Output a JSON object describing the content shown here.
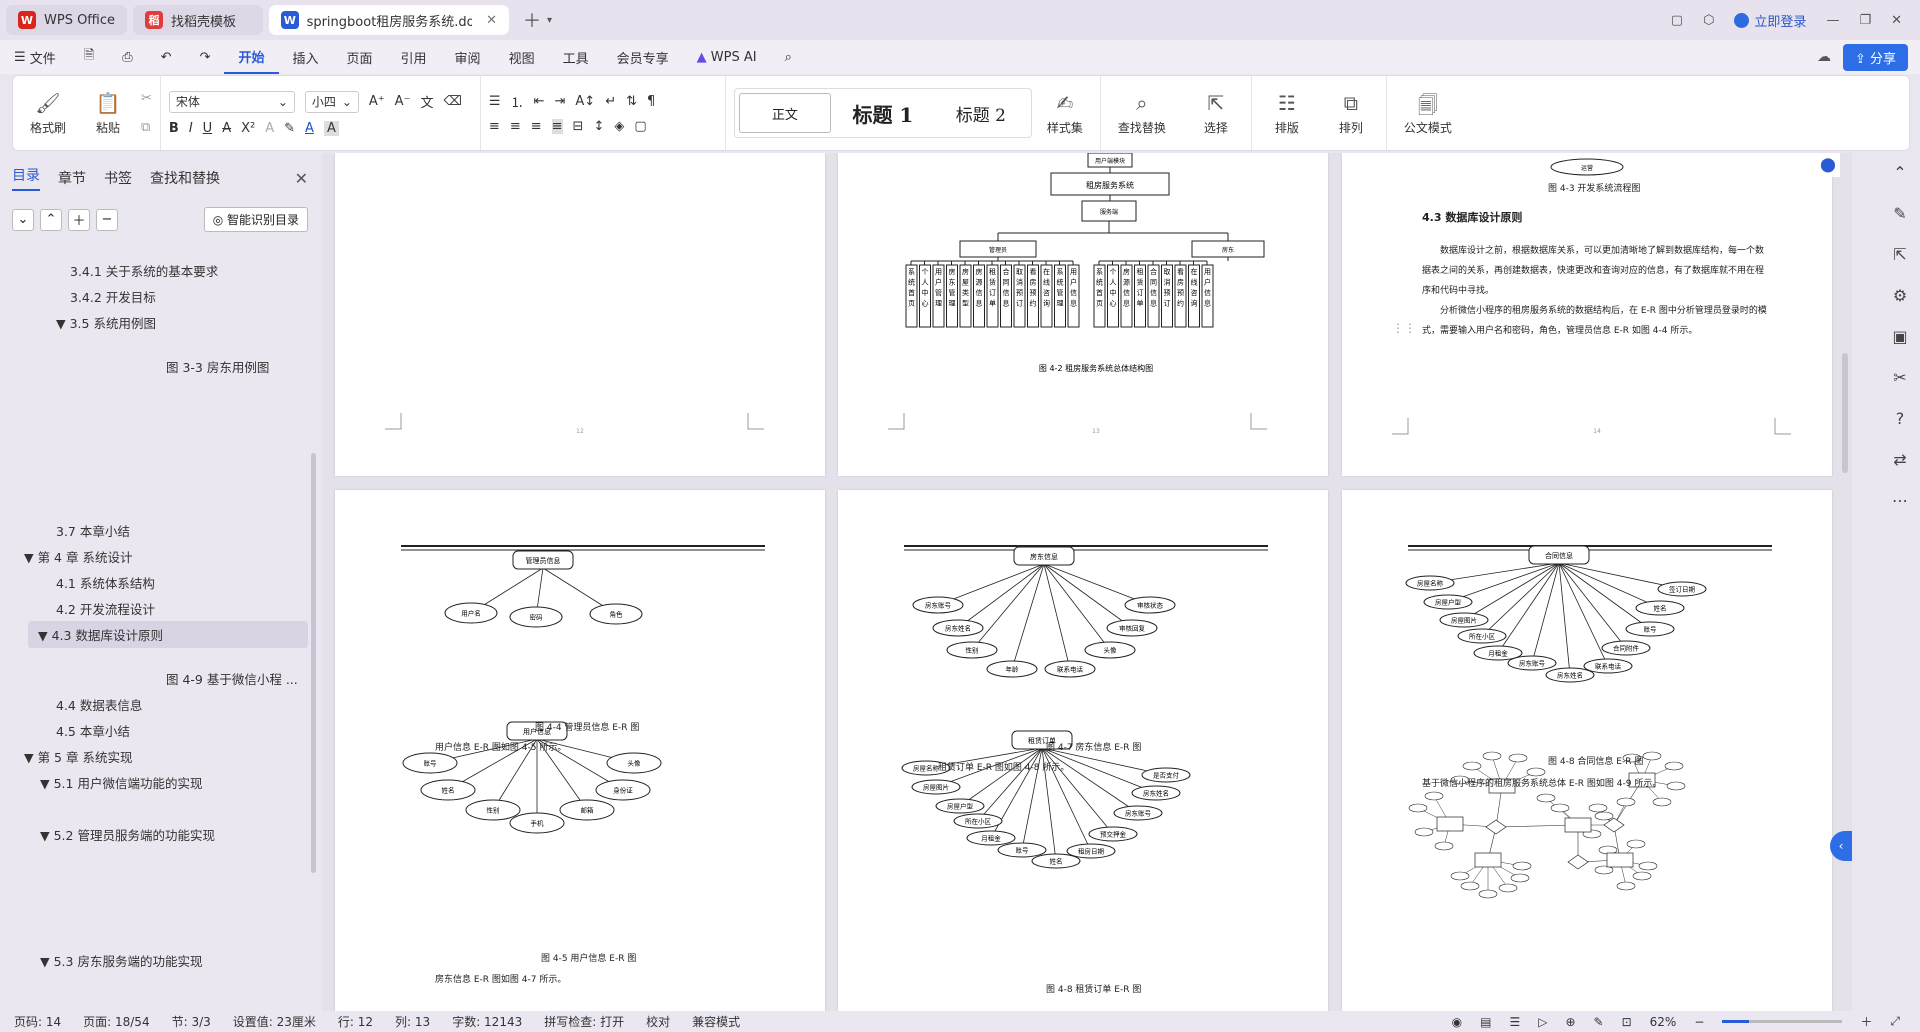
{
  "titlebar": {
    "tabs": [
      {
        "label": "WPS Office",
        "icon": "wps-logo-icon",
        "color": "#d9261c"
      },
      {
        "label": "找稻壳模板",
        "icon": "docer-icon",
        "color": "#e23b3b"
      },
      {
        "label": "springboot租房服务系统.doc",
        "icon": "word-doc-icon",
        "color": "#2a5bd7"
      }
    ],
    "login": "立即登录"
  },
  "menu": {
    "file": "文件",
    "items": [
      "开始",
      "插入",
      "页面",
      "引用",
      "审阅",
      "视图",
      "工具",
      "会员专享"
    ],
    "active": "开始",
    "ai": "WPS AI",
    "share": "分享"
  },
  "ribbon": {
    "format_painter": "格式刷",
    "paste": "粘贴",
    "font": "宋体",
    "size": "小四",
    "styles": [
      "正文",
      "标题 1",
      "标题 2"
    ],
    "style_set": "样式集",
    "find_replace": "查找替换",
    "select": "选择",
    "layout": "排版",
    "arrange": "排列",
    "doc_mode": "公文模式"
  },
  "nav": {
    "tabs": [
      "目录",
      "章节",
      "书签",
      "查找和替换"
    ],
    "smart": "智能识别目录",
    "toc": [
      {
        "label": "3.4.1  关于系统的基本要求"
      },
      {
        "label": "3.4.2 开发目标"
      },
      {
        "label": "▼ 3.5 系统用例图"
      },
      {
        "label": "图 3-3 房东用例图"
      },
      {
        "label": "3.7   本章小结"
      },
      {
        "label": "▼ 第 4 章    系统设计"
      },
      {
        "label": "4.1    系统体系结构"
      },
      {
        "label": "4.2   开发流程设计"
      },
      {
        "label": "▼ 4.3   数据库设计原则"
      },
      {
        "label": "图 4-9 基于微信小程 ..."
      },
      {
        "label": "4.4    数据表信息"
      },
      {
        "label": "4.5    本章小结"
      },
      {
        "label": "▼ 第 5 章    系统实现"
      },
      {
        "label": "▼ 5.1 用户微信端功能的实现"
      },
      {
        "label": "▼ 5.2 管理员服务端的功能实现"
      },
      {
        "label": "▼ 5.3 房东服务端的功能实现"
      }
    ]
  },
  "pages": {
    "p2": {
      "top_box": "用户端模块",
      "title": "租房服务系统",
      "mid": "服务端",
      "left": "管理员",
      "right": "房东",
      "left_leaves": [
        "系统首页",
        "个人中心",
        "用户管理",
        "房东管理",
        "房屋类型",
        "房源信息",
        "租赁订单",
        "合同信息",
        "取消预订",
        "看房预约",
        "在线咨询",
        "系统管理",
        "用户信息"
      ],
      "right_leaves": [
        "系统首页",
        "个人中心",
        "房源信息",
        "租赁订单",
        "合同信息",
        "取消预订",
        "看房预约",
        "在线咨询",
        "用户信息"
      ],
      "caption": "图 4-2  租房服务系统总体结构图",
      "pnum": "13"
    },
    "p1": {
      "pnum": "12"
    },
    "p3": {
      "top_node": "运营",
      "caption": "图 4-3 开发系统流程图",
      "heading": "4.3   数据库设计原则",
      "para1": "数据库设计之前，根据数据库关系，可以更加清晰地了解到数据库结构，每一个数据表之间的关系，再创建数据表，快速更改和查询对应的信息，有了数据库就不用在程序和代码中寻找。",
      "para2": "分析微信小程序的租房服务系统的数据结构后，在 E-R 图中分析管理员登录时的模式，需要输入用户名和密码，角色，管理员信息 E-R 如图 4-4 所示。",
      "pnum": "14"
    },
    "p4": {
      "admin_entity": "管理员信息",
      "admin_attrs": [
        "用户名",
        "密码",
        "角色"
      ],
      "caption1": "图 4-4  管理员信息 E-R 图",
      "text1": "用户信息 E-R 图如图 4-5 所示。",
      "user_entity": "用户信息",
      "user_attrs": [
        "账号",
        "头像",
        "姓名",
        "身份证",
        "性别",
        "邮箱",
        "手机"
      ],
      "caption2": "图 4-5 用户信息 E-R 图",
      "text2": "房东信息 E-R 图如图 4-7 所示。"
    },
    "p5": {
      "landlord_entity": "房东信息",
      "landlord_attrs": [
        "房东账号",
        "审核状态",
        "房东姓名",
        "审核回复",
        "性别",
        "头像",
        "年龄",
        "联系电话"
      ],
      "caption1": "图 4-7 房东信息 E-R 图",
      "text1": "租赁订单 E-R 图如图 4-8 所示。",
      "order_entity": "租赁订单",
      "order_attrs": [
        "房屋名称",
        "是否支付",
        "房屋图片",
        "房东姓名",
        "房屋户型",
        "房东账号",
        "所在小区",
        "预交押金",
        "月租金",
        "账号",
        "姓名",
        "租房日期"
      ],
      "caption2": "图 4-8 租赁订单 E-R 图"
    },
    "p6": {
      "contract_entity": "合同信息",
      "contract_attrs": [
        "房屋名称",
        "签订日期",
        "房屋户型",
        "姓名",
        "房屋图片",
        "账号",
        "所在小区",
        "合同附件",
        "月租金",
        "房东账号",
        "房东姓名",
        "联系电话"
      ],
      "caption1": "图 4-8 合同信息 E-R 图",
      "text1": "基于微信小程序的租房服务系统总体 E-R 图如图 4-9 所示。"
    }
  },
  "status": {
    "page": "页码: 14",
    "pages": "页面: 18/54",
    "section": "节: 3/3",
    "setting": "设置值: 23厘米",
    "line": "行: 12",
    "col": "列: 13",
    "words": "字数: 12143",
    "spell": "拼写检查: 打开",
    "proof": "校对",
    "compat": "兼容模式",
    "zoom": "62%",
    "zoom_fraction": 0.22
  }
}
